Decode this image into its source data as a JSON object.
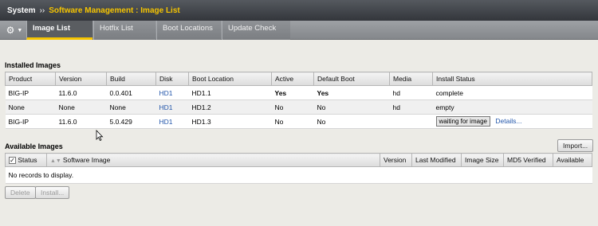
{
  "breadcrumb": {
    "root": "System",
    "separator": "››",
    "current": "Software Management : Image List"
  },
  "tabs": [
    {
      "label": "Image List",
      "active": true
    },
    {
      "label": "Hotfix List",
      "active": false
    },
    {
      "label": "Boot Locations",
      "active": false
    },
    {
      "label": "Update Check",
      "active": false
    }
  ],
  "installed": {
    "title": "Installed Images",
    "columns": [
      "Product",
      "Version",
      "Build",
      "Disk",
      "Boot Location",
      "Active",
      "Default Boot",
      "Media",
      "Install Status"
    ],
    "rows": [
      {
        "product": "BIG-IP",
        "version": "11.6.0",
        "build": "0.0.401",
        "disk": "HD1",
        "boot_location": "HD1.1",
        "active": "Yes",
        "default_boot": "Yes",
        "media": "hd",
        "install_status": "complete"
      },
      {
        "product": "None",
        "version": "None",
        "build": "None",
        "disk": "HD1",
        "boot_location": "HD1.2",
        "active": "No",
        "default_boot": "No",
        "media": "hd",
        "install_status": "empty"
      },
      {
        "product": "BIG-IP",
        "version": "11.6.0",
        "build": "5.0.429",
        "disk": "HD1",
        "boot_location": "HD1.3",
        "active": "No",
        "default_boot": "No",
        "media": "",
        "install_status": "waiting for image",
        "details_link": "Details..."
      }
    ]
  },
  "available": {
    "title": "Available Images",
    "import_label": "Import...",
    "columns": [
      "Status",
      "Software Image",
      "Version",
      "Last Modified",
      "Image Size",
      "MD5 Verified",
      "Available"
    ],
    "empty_message": "No records to display.",
    "delete_label": "Delete",
    "install_label": "Install..."
  },
  "colors": {
    "accent": "#f5c400",
    "link": "#2255aa",
    "titlebar": "#3a3d42"
  }
}
